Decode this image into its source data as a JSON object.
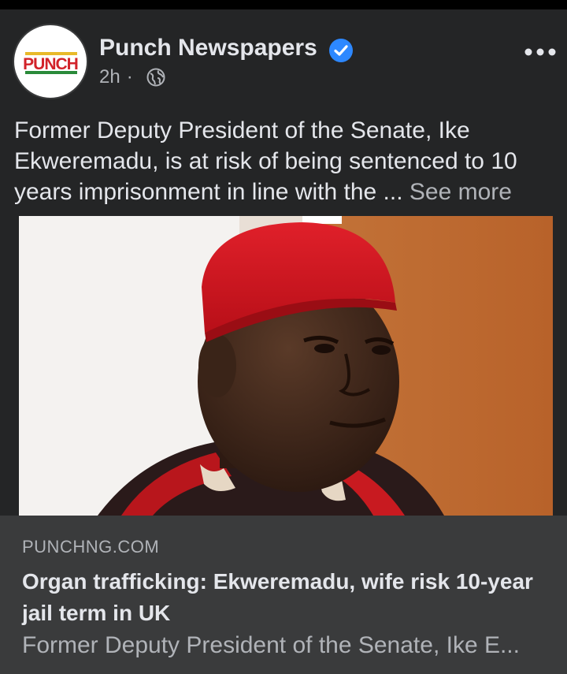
{
  "post": {
    "page_name": "Punch Newspapers",
    "time": "2h",
    "separator": "·",
    "text": "Former Deputy President of the Senate, Ike Ekweremadu, is at risk of being sentenced to 10 years imprisonment in line with the ...",
    "see_more": "See more",
    "avatar_logo_text": "PUNCH",
    "verified_icon": "verified-badge-icon",
    "audience_icon": "globe-icon",
    "menu_icon": "more-options-icon"
  },
  "link_preview": {
    "domain": "PUNCHNG.COM",
    "headline": "Organ trafficking: Ekweremadu, wife risk 10-year jail term in UK",
    "description": "Former Deputy President of the Senate, Ike E..."
  },
  "colors": {
    "background": "#18191a",
    "card": "#242526",
    "footer": "#3a3b3c",
    "verified": "#2d88ff",
    "cap": "#d1141f"
  }
}
